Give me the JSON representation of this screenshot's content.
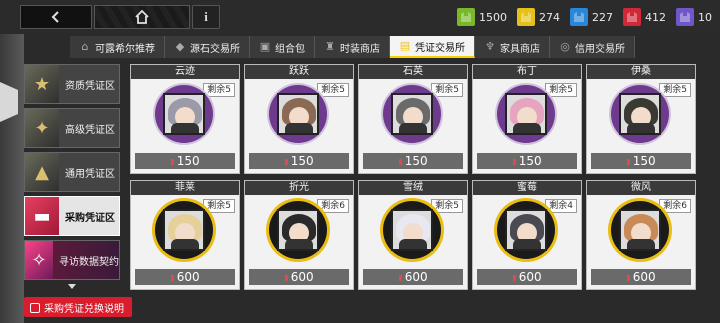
{
  "topbar": {
    "back_icon": "chevron-left-icon",
    "home_icon": "home-icon",
    "info_label": "i",
    "currencies": [
      {
        "icon": "green-token-icon",
        "color": "#7ab82b",
        "value": "1500"
      },
      {
        "icon": "yellow-token-icon",
        "color": "#e4c21a",
        "value": "274"
      },
      {
        "icon": "blue-token-icon",
        "color": "#2a86d6",
        "value": "227"
      },
      {
        "icon": "red-token-icon",
        "color": "#d02838",
        "value": "412"
      },
      {
        "icon": "purple-token-icon",
        "color": "#7056c8",
        "value": "10"
      }
    ]
  },
  "tabs": [
    {
      "label": "可露希尔推荐",
      "icon": "shop-icon",
      "active": false
    },
    {
      "label": "源石交易所",
      "icon": "crystal-icon",
      "active": false
    },
    {
      "label": "组合包",
      "icon": "package-icon",
      "active": false
    },
    {
      "label": "时装商店",
      "icon": "outfit-icon",
      "active": false
    },
    {
      "label": "凭证交易所",
      "icon": "voucher-icon",
      "active": true
    },
    {
      "label": "家具商店",
      "icon": "furniture-icon",
      "active": false
    },
    {
      "label": "信用交易所",
      "icon": "credit-icon",
      "active": false
    }
  ],
  "side": {
    "items": [
      {
        "label": "资质凭证区",
        "active": false
      },
      {
        "label": "高级凭证区",
        "active": false
      },
      {
        "label": "通用凭证区",
        "active": false
      },
      {
        "label": "采购凭证区",
        "active": true
      },
      {
        "label": "寻访数据契约",
        "active": false
      }
    ],
    "exchange_label": "采购凭证兑换说明"
  },
  "shop": {
    "currency_icon": "purchase-voucher-icon",
    "rows": [
      [
        {
          "name": "云迹",
          "stock": "剩余5",
          "price": "150",
          "frame": "purple",
          "hair": "#9a9aa8"
        },
        {
          "name": "跃跃",
          "stock": "剩余5",
          "price": "150",
          "frame": "purple",
          "hair": "#8a6a52"
        },
        {
          "name": "石英",
          "stock": "剩余5",
          "price": "150",
          "frame": "purple",
          "hair": "#6a6a6a"
        },
        {
          "name": "布丁",
          "stock": "剩余5",
          "price": "150",
          "frame": "purple",
          "hair": "#e6a4c0"
        },
        {
          "name": "伊桑",
          "stock": "剩余5",
          "price": "150",
          "frame": "purple",
          "hair": "#3a3a32"
        }
      ],
      [
        {
          "name": "菲莱",
          "stock": "剩余5",
          "price": "600",
          "frame": "gold",
          "hair": "#e6d09a"
        },
        {
          "name": "折光",
          "stock": "剩余6",
          "price": "600",
          "frame": "gold",
          "hair": "#2a2a2a"
        },
        {
          "name": "雪绒",
          "stock": "剩余5",
          "price": "600",
          "frame": "gold",
          "hair": "#e8e8f0"
        },
        {
          "name": "蜜莓",
          "stock": "剩余4",
          "price": "600",
          "frame": "gold",
          "hair": "#4a4a52"
        },
        {
          "name": "微风",
          "stock": "剩余6",
          "price": "600",
          "frame": "gold",
          "hair": "#c88a56"
        }
      ]
    ]
  }
}
